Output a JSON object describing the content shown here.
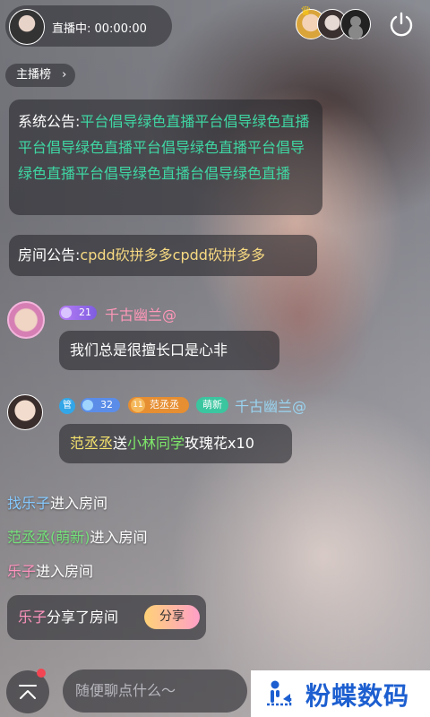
{
  "header": {
    "live_status": "直播中: 00:00:00",
    "ranking_label": "主播榜",
    "ranking_chevron": "›"
  },
  "icons": {
    "power": "power-icon",
    "expand": "chevron-up-icon",
    "level": "diamond-icon"
  },
  "messages": {
    "system_announcement": {
      "label": "系统公告:",
      "text": "平台倡导绿色直播平台倡导绿色直播平台倡导绿色直播平台倡导绿色直播平台倡导绿色直播平台倡导绿色直播台倡导绿色直播"
    },
    "room_announcement": {
      "label": "房间公告:",
      "text": "cpdd砍拼多多cpdd砍拼多多"
    },
    "chat1": {
      "level": "21",
      "nickname": "千古幽兰@",
      "text": "我们总是很擅长口是心非"
    },
    "chat2": {
      "admin_tag": "管",
      "level": "32",
      "fan_level": "11",
      "fan_name": "范丞丞",
      "cute_tag": "萌新",
      "nickname": "千古幽兰@",
      "gift_sender": "范丞丞",
      "gift_verb": "送",
      "gift_receiver": "小林同学",
      "gift_item": "玫瑰花x10"
    },
    "entries": [
      {
        "name": "找乐子",
        "action": "进入房间"
      },
      {
        "name": "范丞丞(萌新)",
        "action": "进入房间"
      },
      {
        "name": "乐子",
        "action": "进入房间"
      }
    ],
    "share": {
      "name": "乐子",
      "action": "分享了房间",
      "button_label": "分享"
    }
  },
  "bottom_bar": {
    "chat_placeholder": "随便聊点什么～"
  },
  "watermark": {
    "text": "粉蝶数码"
  },
  "colors": {
    "announcement_green": "#3fd7a3",
    "room_yellow": "#f7d982",
    "nickname_pink": "#ff97b8",
    "nickname_blue": "#9ad4f0",
    "share_button_gradient": [
      "#ffd277",
      "#ff9fc8"
    ],
    "watermark_blue": "#1d5fd0"
  }
}
